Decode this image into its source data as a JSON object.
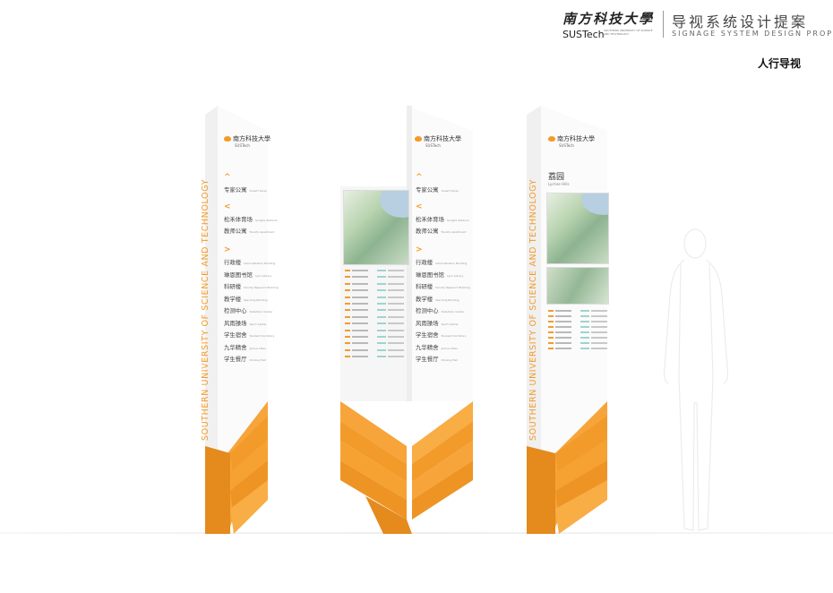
{
  "header": {
    "brand_cn": "南方科技大學",
    "brand_en": "SUSTech",
    "brand_en_full": "SOUTHERN UNIVERSITY OF SCIENCE AND TECHNOLOGY",
    "proposal_cn": "导视系统设计提案",
    "proposal_en": "SIGNAGE SYSTEM DESIGN PROPOSAL",
    "section_title": "人行导视"
  },
  "colors": {
    "accent": "#f39b2a",
    "panel": "#fbfbfb"
  },
  "signs": {
    "left": {
      "vertical_text": "SOUTHERN UNIVERSITY OF SCIENCE AND TECHNOLOGY",
      "logo_cn": "南方科技大學",
      "logo_en": "SUSTech",
      "groups": [
        {
          "arrow": "^",
          "items": [
            {
              "cn": "专家公寓",
              "en": "Guest House"
            }
          ]
        },
        {
          "arrow": "<",
          "items": [
            {
              "cn": "松禾体育场",
              "en": "Songhe Stadium"
            },
            {
              "cn": "教师公寓",
              "en": "Faculty Apartment"
            }
          ]
        },
        {
          "arrow": ">",
          "items": [
            {
              "cn": "行政楼",
              "en": "Administration Building"
            },
            {
              "cn": "琳恩图书馆",
              "en": "Lynn Library"
            },
            {
              "cn": "科研楼",
              "en": "Faculty Research Building"
            },
            {
              "cn": "教学楼",
              "en": "Teaching Building"
            },
            {
              "cn": "检测中心",
              "en": "Detection Center"
            },
            {
              "cn": "风雨操场",
              "en": "Sport Center"
            },
            {
              "cn": "学生宿舍",
              "en": "Student Dormitory"
            },
            {
              "cn": "九华精舍",
              "en": "Jiuhua Villas"
            },
            {
              "cn": "学生餐厅",
              "en": "Dinning Hall"
            }
          ]
        }
      ]
    },
    "middle": {
      "logo_cn": "南方科技大學",
      "logo_en": "SUSTech",
      "groups": [
        {
          "arrow": "^",
          "items": [
            {
              "cn": "专家公寓",
              "en": "Guest House"
            }
          ]
        },
        {
          "arrow": "<",
          "items": [
            {
              "cn": "松禾体育场",
              "en": "Songhe Stadium"
            },
            {
              "cn": "教师公寓",
              "en": "Faculty Apartment"
            }
          ]
        },
        {
          "arrow": ">",
          "items": [
            {
              "cn": "行政楼",
              "en": "Administration Building"
            },
            {
              "cn": "琳恩图书馆",
              "en": "Lynn Library"
            },
            {
              "cn": "科研楼",
              "en": "Faculty Research Building"
            },
            {
              "cn": "教学楼",
              "en": "Teaching Building"
            },
            {
              "cn": "检测中心",
              "en": "Detection Center"
            },
            {
              "cn": "风雨操场",
              "en": "Sport Center"
            },
            {
              "cn": "学生宿舍",
              "en": "Student Dormitory"
            },
            {
              "cn": "九华精舍",
              "en": "Jiuhua Villas"
            },
            {
              "cn": "学生餐厅",
              "en": "Dinning Hall"
            }
          ]
        }
      ]
    },
    "right": {
      "vertical_text": "SOUTHERN UNIVERSITY OF SCIENCE AND TECHNOLOGY",
      "logo_cn": "南方科技大學",
      "logo_en": "SUSTech",
      "place_cn": "荔园",
      "place_en": "Lychee Hills"
    }
  }
}
